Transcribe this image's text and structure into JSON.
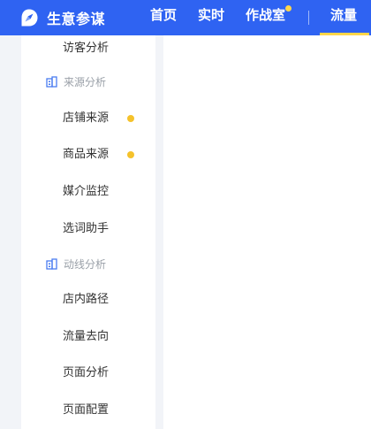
{
  "header": {
    "brand_name": "生意参谋",
    "brand_icon": "compass-icon",
    "nav": {
      "home": "首页",
      "realtime": "实时",
      "studio": "作战室",
      "traffic": "流量"
    },
    "accent_color": "#2f63f2",
    "highlight_color": "#ffd64a"
  },
  "sidebar": {
    "item_top": "访客分析",
    "group_source": {
      "label": "来源分析",
      "icon": "building-icon"
    },
    "shop_source": "店铺来源",
    "product_source": "商品来源",
    "media_monitor": "媒介监控",
    "keyword_helper": "选词助手",
    "group_flow": {
      "label": "动线分析",
      "icon": "building-icon"
    },
    "store_path": "店内路径",
    "traffic_destination": "流量去向",
    "page_analysis": "页面分析",
    "page_config": "页面配置",
    "dot_color": "#f5c22b"
  }
}
